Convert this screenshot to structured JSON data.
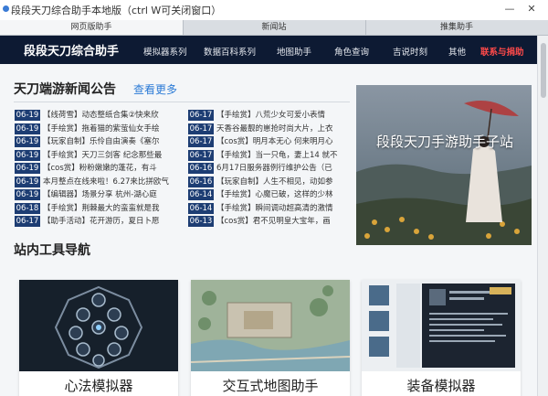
{
  "window": {
    "title": "段段天刀综合助手本地版（ctrl W可关闭窗口）",
    "minimize_label": "—",
    "close_label": "✕"
  },
  "tabs": [
    {
      "label": "网页版助手"
    },
    {
      "label": "新闻站"
    },
    {
      "label": "推集助手"
    }
  ],
  "nav": {
    "brand": "段段天刀综合助手",
    "items": [
      {
        "label": "模拟器系列"
      },
      {
        "label": "数据百科系列"
      },
      {
        "label": "地图助手"
      },
      {
        "label": "角色查询"
      },
      {
        "label": "吉说时刻"
      },
      {
        "label": "其他"
      },
      {
        "label": "联系与捐助"
      }
    ]
  },
  "news": {
    "title": "天刀端游新闻公告",
    "more": "查看更多",
    "left": [
      {
        "date": "06-19",
        "text": "【线荷雪】动态整纸合集②快来欣"
      },
      {
        "date": "06-19",
        "text": "【手绘赏】拖着猫的紫萤仙女手绘"
      },
      {
        "date": "06-19",
        "text": "【玩家自制】乐伶自由演奏《塞尔"
      },
      {
        "date": "06-19",
        "text": "【手绘赏】天刀三剑客 纪念那些最"
      },
      {
        "date": "06-19",
        "text": "【cos赏】粉粉嫩嫩的蓬花，有斗"
      },
      {
        "date": "06-19",
        "text": "本月整点在线来啦！6.27来比拼欧气"
      },
      {
        "date": "06-19",
        "text": "【编辑器】场景分享 杭州-湖心庭"
      },
      {
        "date": "06-18",
        "text": "【手绘赏】荆棘最大的蛮蛮就是我"
      },
      {
        "date": "06-17",
        "text": "【助手活动】花开游历，夏日卜愿"
      }
    ],
    "right": [
      {
        "date": "06-17",
        "text": "【手绘赏】八荒少女可爱小表情"
      },
      {
        "date": "06-17",
        "text": "天香谷最靓的崽抢时尚大片，上衣"
      },
      {
        "date": "06-17",
        "text": "【cos赏】明月本无心 何来明月心"
      },
      {
        "date": "06-17",
        "text": "【手绘赏】当一只龟，妻上14 就不"
      },
      {
        "date": "06-16",
        "text": "6月17日服务器例行维护公告（已"
      },
      {
        "date": "06-16",
        "text": "【玩家自制】人生不相见，动如参"
      },
      {
        "date": "06-14",
        "text": "【手绘赏】心魔已破，这样的少林"
      },
      {
        "date": "06-14",
        "text": "【手绘赏】瞬间调动超高清的激情"
      },
      {
        "date": "06-13",
        "text": "【cos赏】君不见明皇大宝年，画"
      }
    ]
  },
  "banner": {
    "text": "段段天刀手游助手子站"
  },
  "tools": {
    "title": "站内工具导航",
    "cards": [
      {
        "label": "心法模拟器"
      },
      {
        "label": "交互式地图助手"
      },
      {
        "label": "装备模拟器"
      }
    ]
  },
  "colors": {
    "nav_bg": "#0d1a33",
    "date_badge": "#1d3d73",
    "link_blue": "#2c7bd6",
    "highlight_red": "#ff4a4a"
  }
}
